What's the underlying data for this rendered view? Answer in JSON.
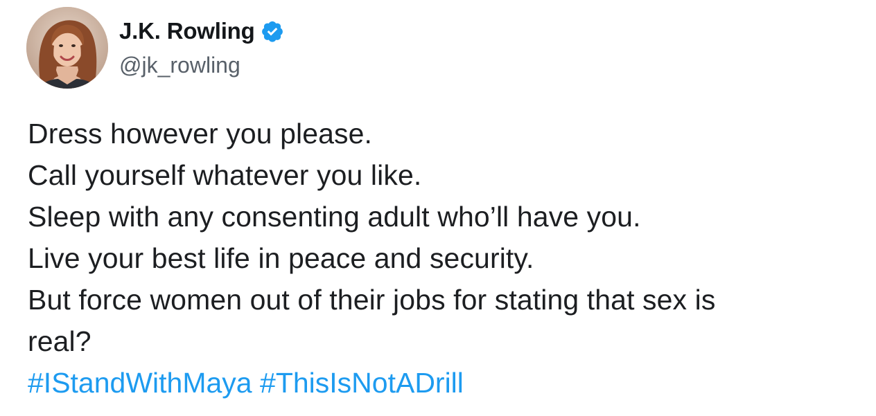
{
  "author": {
    "display_name": "J.K. Rowling",
    "handle": "@jk_rowling",
    "verified_icon": "verified-badge-icon"
  },
  "tweet": {
    "lines": [
      "Dress however you please.",
      "Call yourself whatever you like.",
      "Sleep with any consenting adult who’ll have you.",
      "Live your best life in peace and security.",
      "But force women out of their jobs for stating that sex is",
      "real?"
    ],
    "hashtags": [
      "#IStandWithMaya",
      "#ThisIsNotADrill"
    ]
  },
  "colors": {
    "text": "#14171a",
    "handle": "#586069",
    "link": "#1d9bf0",
    "verified": "#1d9bf0"
  }
}
